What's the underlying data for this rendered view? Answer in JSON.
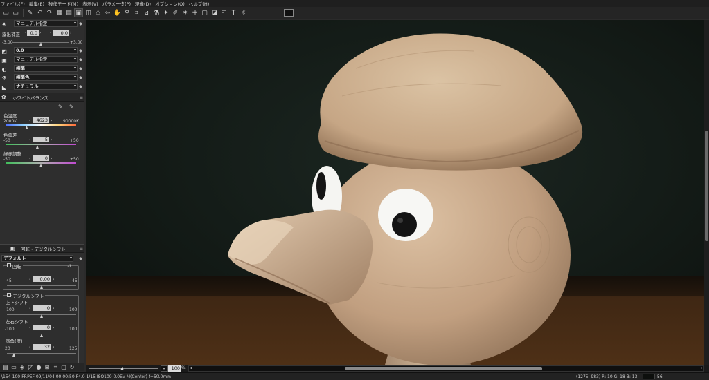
{
  "menu": [
    "ファイル(F)",
    "編集(E)",
    "操作モード(M)",
    "表示(V)",
    "パラメータ(P)",
    "現像(D)",
    "オプション(O)",
    "ヘルプ(H)"
  ],
  "toolbar_icons": [
    "open-folder-icon",
    "save-folder-icon",
    "brush-icon",
    "undo-icon",
    "redo-icon",
    "thumbnail-grid-icon",
    "filmstrip-icon",
    "single-view-icon",
    "compare-icon",
    "warning-icon",
    "arrow-icon",
    "zoom-icon",
    "crop-icon",
    "straighten-icon",
    "eyedropper-icon",
    "wand-icon",
    "spot-icon",
    "stamp-icon",
    "copy-settings-icon",
    "paste-settings-icon",
    "develop-icon",
    "convert-icon"
  ],
  "left": {
    "exposure_mode": "マニュアル指定",
    "exposure_label": "露出補正",
    "exposure_value_left": "0.0",
    "exposure_value_right": "0.0",
    "exposure_min": "-3.00",
    "exposure_max": "+3.00",
    "exposure_level": 0.5,
    "contrast_value": "0.0",
    "dlighting_mode": "マニュアル指定",
    "picture_mode": "標準",
    "color_mode": "標準色",
    "tone_mode": "ナチュラル",
    "wb": {
      "title": "ホワイトバランス",
      "temp_label": "色温度",
      "temp_min": "2000K",
      "temp_value": "4623",
      "temp_max": "90000K",
      "temp_level": 0.3,
      "tint_label": "色偏差",
      "tint_min": "-50",
      "tint_value": "-5",
      "tint_max": "+50",
      "tint_level": 0.45,
      "gm_label": "緑赤調整",
      "gm_min": "-50",
      "gm_value": "0",
      "gm_max": "+50",
      "gm_level": 0.5
    },
    "rot": {
      "title": "回転・デジタルシフト",
      "preset": "デフォルト",
      "rotate_label": "回転",
      "rotate_min": "-45",
      "rotate_value": "0.00",
      "rotate_max": "45",
      "rotate_level": 0.5,
      "shift_label": "デジタルシフト",
      "v_label": "上下シフト",
      "v_min": "-100",
      "v_value": "0",
      "v_max": "100",
      "v_level": 0.5,
      "h_label": "左右シフト",
      "h_min": "-100",
      "h_value": "0",
      "h_max": "100",
      "h_level": 0.5,
      "fov_label": "画角(度)",
      "fov_min": "20",
      "fov_value": "32",
      "fov_max": "125",
      "fov_level": 0.1
    }
  },
  "bottom": {
    "zoom_value": "100",
    "zoom_unit": "%",
    "scroll_left": "◂",
    "scroll_right": "▸"
  },
  "status": {
    "file_info": "\\154-100-FF.PEF 09/11/04 00:00:50 F4.0 1/15 ISO100 0.0EV M(Center) f=50.0mm",
    "coords": "(1275, 983) R: 10 G: 18 B: 13",
    "extra": "56"
  },
  "colors": {
    "background": "#0c0f0d",
    "panel": "#2e2e2e",
    "wood": "#c9a98a"
  }
}
